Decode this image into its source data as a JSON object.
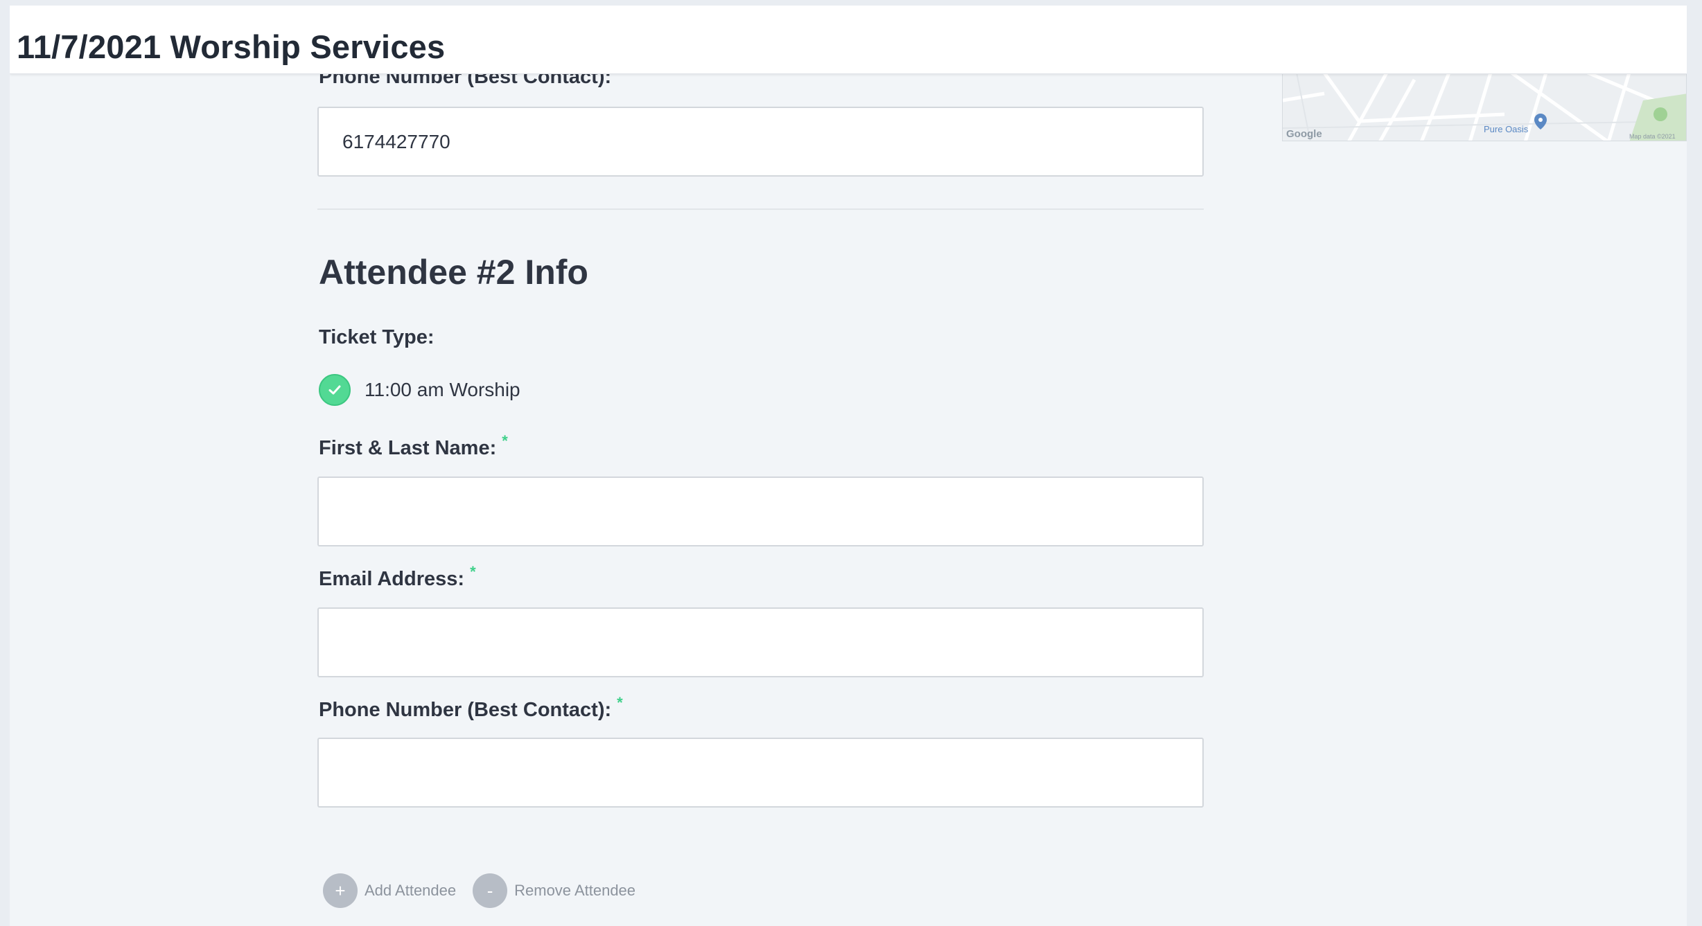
{
  "header": {
    "title": "11/7/2021 Worship Services"
  },
  "map": {
    "provider_label": "Google",
    "place_label": "Pure Oasis",
    "attribution": "Map data ©2021"
  },
  "attendee1": {
    "phone_label": "Phone Number (Best Contact):",
    "phone_value": "6174427770"
  },
  "attendee2": {
    "heading": "Attendee #2 Info",
    "ticket_type_label": "Ticket Type:",
    "ticket_option": "11:00 am Worship",
    "name_label": "First & Last Name:",
    "name_value": "",
    "email_label": "Email Address:",
    "email_value": "",
    "phone_label": "Phone Number (Best Contact):",
    "phone_value": "",
    "required_mark": "*"
  },
  "actions": {
    "add_symbol": "+",
    "add_label": "Add Attendee",
    "remove_symbol": "-",
    "remove_label": "Remove Attendee"
  },
  "colors": {
    "accent_green": "#52d994",
    "heading_text": "#2f3542",
    "muted_button": "#b7bdc6"
  }
}
